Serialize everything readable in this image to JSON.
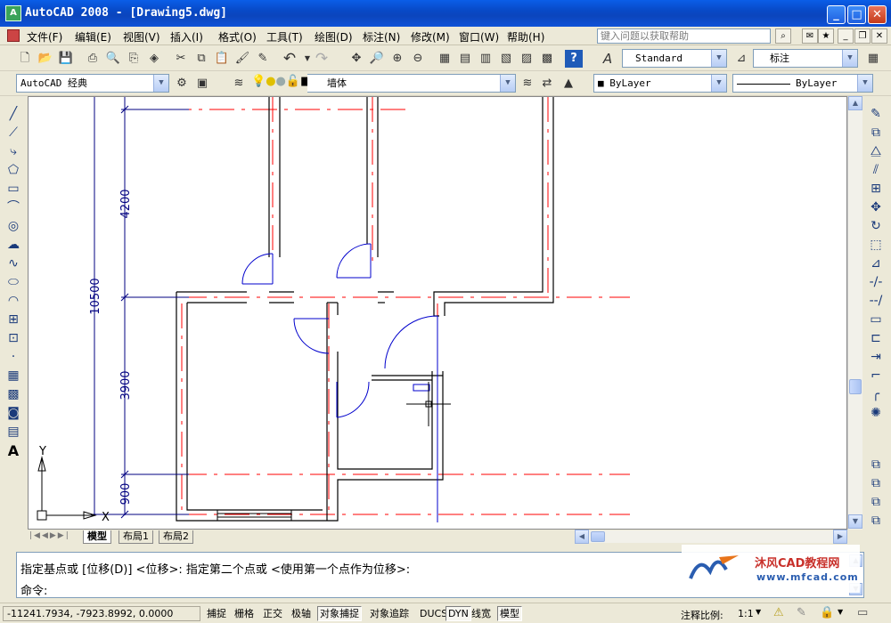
{
  "window": {
    "title": "AutoCAD 2008 - [Drawing5.dwg]",
    "app_icon": "autocad-icon"
  },
  "menu": {
    "items": [
      "文件(F)",
      "编辑(E)",
      "视图(V)",
      "插入(I)",
      "格式(O)",
      "工具(T)",
      "绘图(D)",
      "标注(N)",
      "修改(M)",
      "窗口(W)",
      "帮助(H)"
    ],
    "help_placeholder": "键入问题以获取帮助"
  },
  "toolbar": {
    "text_style": "Standard",
    "dim_style": "标注",
    "workspace": "AutoCAD 经典",
    "layer": "墙体",
    "color": "ByLayer",
    "linetype": "ByLayer"
  },
  "drawing": {
    "dimensions": [
      "10500",
      "4200",
      "3900",
      "900"
    ],
    "ucs_x": "X",
    "ucs_y": "Y"
  },
  "layout_tabs": [
    "模型",
    "布局1",
    "布局2"
  ],
  "command": {
    "history": "指定基点或 [位移(D)] <位移>:  指定第二个点或 <使用第一个点作为位移>:",
    "prompt": "命令:"
  },
  "status": {
    "coordinates": "-11241.7934, -7923.8992, 0.0000",
    "toggles": [
      "捕捉",
      "栅格",
      "正交",
      "极轴",
      "对象捕捉",
      "对象追踪",
      "DUCS",
      "DYN",
      "线宽",
      "模型"
    ],
    "annotation_scale_label": "注释比例:",
    "annotation_scale": "1:1"
  },
  "watermark": {
    "brand": "沐风CAD教程网",
    "url": "www.mfcad.com"
  },
  "colors": {
    "titlebar": "#0b45bd",
    "wall": "#000000",
    "axis": "#ff0000",
    "dimension": "#0000aa"
  }
}
